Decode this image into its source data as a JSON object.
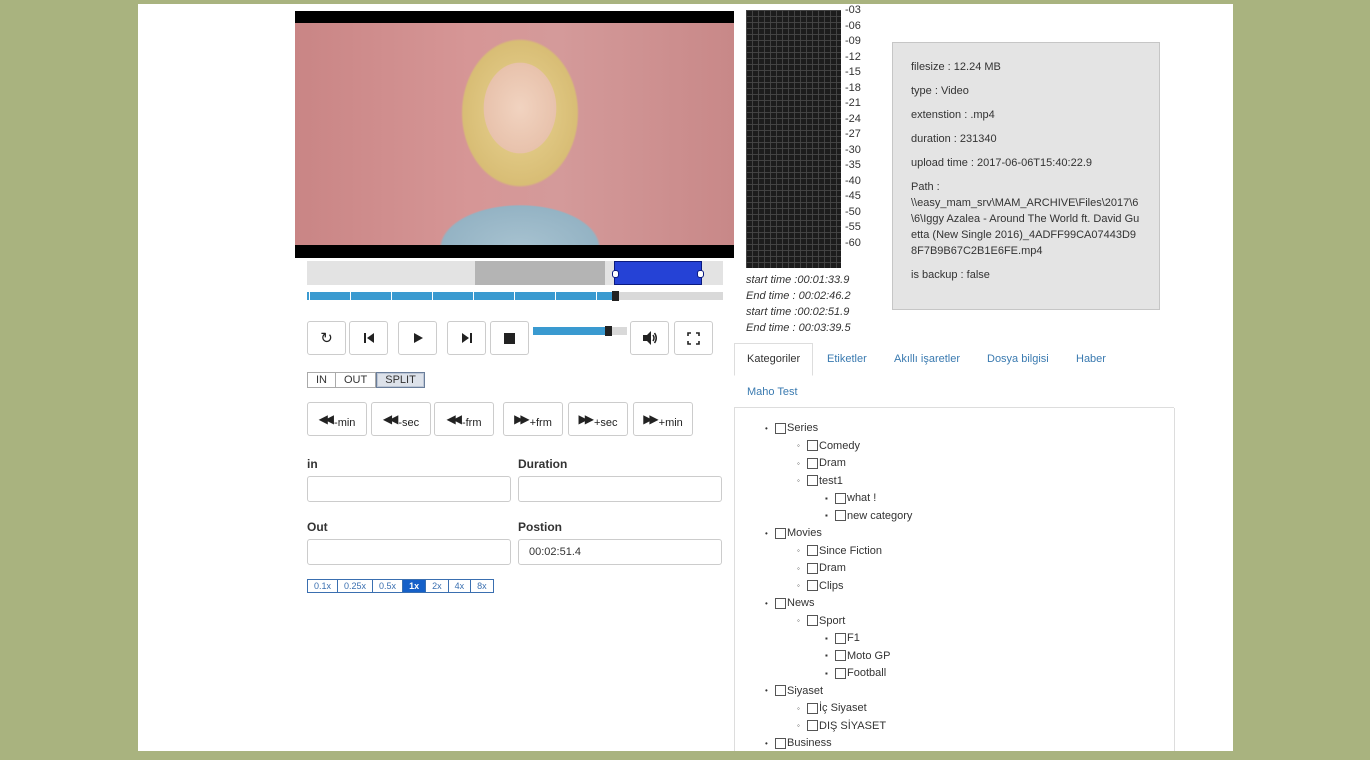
{
  "controls": {
    "in_label": "IN",
    "out_label": "OUT",
    "split_label": "SPLIT",
    "jump_buttons": [
      "-min",
      "-sec",
      "-frm",
      "+frm",
      "+sec",
      "+min"
    ],
    "speeds": [
      "0.1x",
      "0.25x",
      "0.5x",
      "1x",
      "2x",
      "4x",
      "8x"
    ],
    "active_speed": "1x",
    "progress": 0.74,
    "volume": 0.8
  },
  "form": {
    "in_label": "in",
    "in_value": "",
    "duration_label": "Duration",
    "duration_value": "",
    "out_label": "Out",
    "out_value": "",
    "position_label": "Postion",
    "position_value": "00:02:51.4"
  },
  "meter": {
    "ticks": [
      "-03",
      "-06",
      "-09",
      "-12",
      "-15",
      "-18",
      "-21",
      "-24",
      "-27",
      "-30",
      "-35",
      "-40",
      "-45",
      "-50",
      "-55",
      "-60"
    ]
  },
  "segments": [
    "start time :00:01:33.9",
    "End time : 00:02:46.2",
    "start time :00:02:51.9",
    "End time : 00:03:39.5"
  ],
  "info": {
    "filesize": "filesize : 12.24 MB",
    "type": "type : Video",
    "extension": "extenstion : .mp4",
    "duration": "duration : 231340",
    "upload_time": "upload time : 2017-06-06T15:40:22.9",
    "path_label": "Path :",
    "path_value": "\\\\easy_mam_srv\\MAM_ARCHIVE\\Files\\2017\\6\\6\\Iggy Azalea - Around The World ft. David Guetta (New Single 2016)_4ADFF99CA07443D98F7B9B67C2B1E6FE.mp4",
    "is_backup": "is backup : false"
  },
  "tabs": [
    "Kategoriler",
    "Etiketler",
    "Akıllı işaretler",
    "Dosya bilgisi",
    "Haber",
    "Maho Test"
  ],
  "tree": [
    {
      "label": "Series",
      "level": 0
    },
    {
      "label": "Comedy",
      "level": 1
    },
    {
      "label": "Dram",
      "level": 1
    },
    {
      "label": "test1",
      "level": 1
    },
    {
      "label": "what !",
      "level": 2
    },
    {
      "label": "new category",
      "level": 2
    },
    {
      "label": "Movies",
      "level": 0
    },
    {
      "label": "Since Fiction",
      "level": 1
    },
    {
      "label": "Dram",
      "level": 1
    },
    {
      "label": "Clips",
      "level": 1
    },
    {
      "label": "News",
      "level": 0
    },
    {
      "label": "Sport",
      "level": 1
    },
    {
      "label": "F1",
      "level": 2
    },
    {
      "label": "Moto GP",
      "level": 2
    },
    {
      "label": "Football",
      "level": 2
    },
    {
      "label": "Siyaset",
      "level": 0
    },
    {
      "label": "İç Siyaset",
      "level": 1
    },
    {
      "label": "DIŞ SİYASET",
      "level": 1
    },
    {
      "label": "Business",
      "level": 0
    }
  ]
}
